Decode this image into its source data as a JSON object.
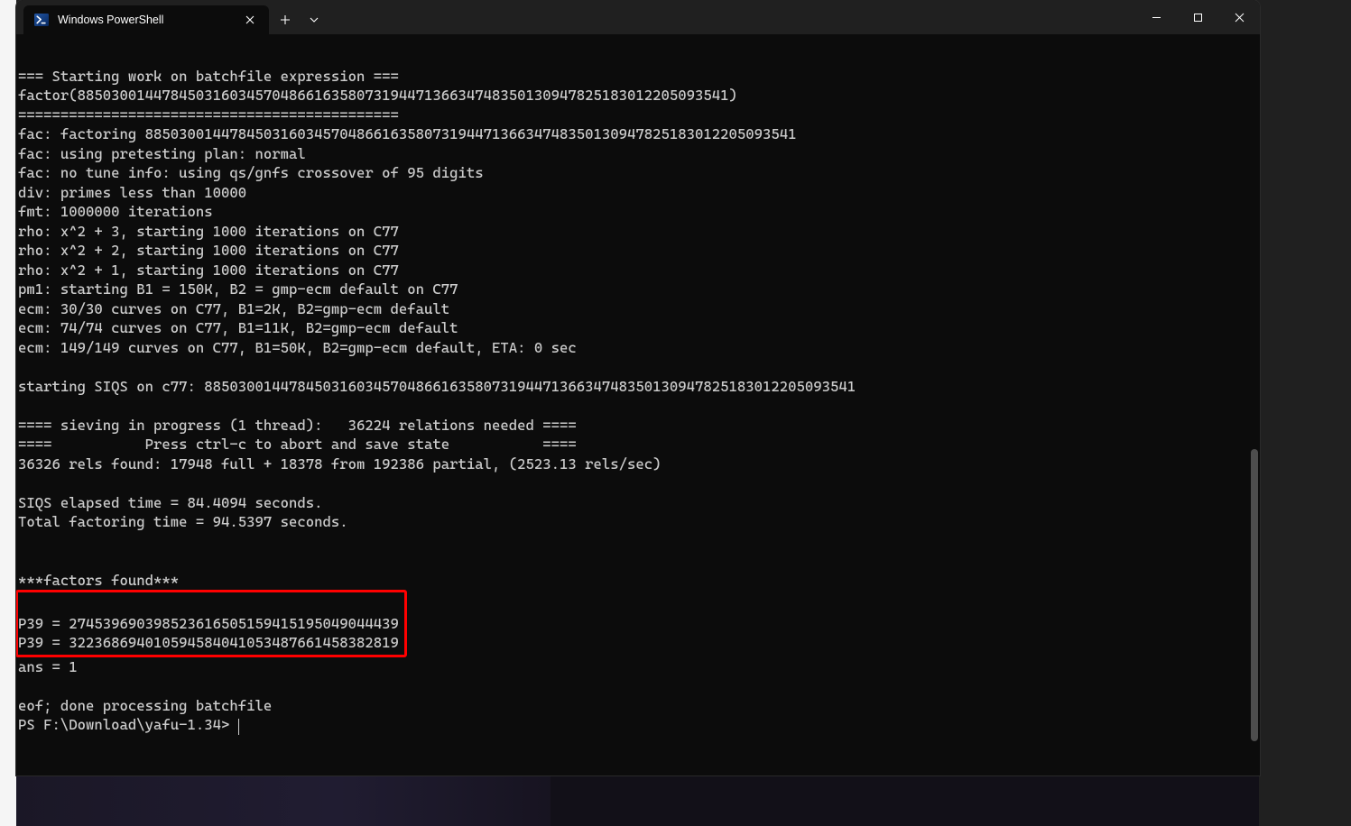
{
  "window": {
    "tab_title": "Windows PowerShell",
    "controls": {
      "new_tab": "+",
      "dropdown": "v"
    }
  },
  "terminal": {
    "lines_head": "\n=== Starting work on batchfile expression ===\nfactor(88503001447845031603457048661635807319447136634748350130947825183012205093541)\n=============================================\nfac: factoring 88503001447845031603457048661635807319447136634748350130947825183012205093541\nfac: using pretesting plan: normal\nfac: no tune info: using qs/gnfs crossover of 95 digits\ndiv: primes less than 10000\nfmt: 1000000 iterations\nrho: x^2 + 3, starting 1000 iterations on C77\nrho: x^2 + 2, starting 1000 iterations on C77\nrho: x^2 + 1, starting 1000 iterations on C77\npm1: starting B1 = 150K, B2 = gmp-ecm default on C77\necm: 30/30 curves on C77, B1=2K, B2=gmp-ecm default\necm: 74/74 curves on C77, B1=11K, B2=gmp-ecm default\necm: 149/149 curves on C77, B1=50K, B2=gmp-ecm default, ETA: 0 sec\n\nstarting SIQS on c77: 88503001447845031603457048661635807319447136634748350130947825183012205093541\n\n==== sieving in progress (1 thread):   36224 relations needed ====\n====           Press ctrl-c to abort and save state           ====\n36326 rels found: 17948 full + 18378 from 192386 partial, (2523.13 rels/sec)\n\nSIQS elapsed time = 84.4094 seconds.\nTotal factoring time = 94.5397 seconds.\n\n\n***factors found***\n",
    "highlight_block": "\nP39 = 274539690398523616505159415195049044439\nP39 = 322368694010594584041053487661458382819\n",
    "lines_tail": "\nans = 1\n\neof; done processing batchfile\n",
    "prompt": "PS F:\\Download\\yafu-1.34> "
  }
}
